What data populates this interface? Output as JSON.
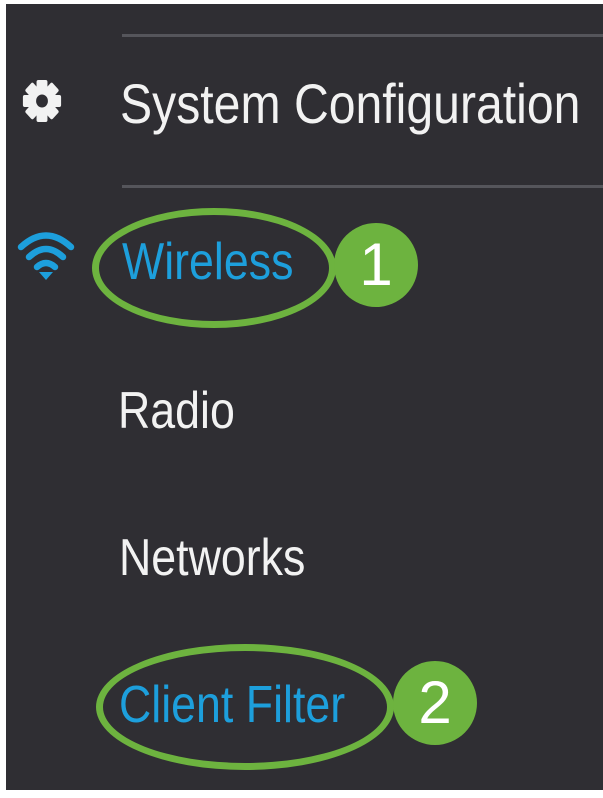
{
  "menu": {
    "system_configuration": "System Configuration",
    "wireless": "Wireless",
    "radio": "Radio",
    "networks": "Networks",
    "client_filter": "Client Filter"
  },
  "icons": {
    "system_configuration": "gear-icon",
    "wireless": "wifi-icon"
  },
  "annotations": {
    "step1": "1",
    "step2": "2"
  },
  "colors": {
    "background": "#2f2e33",
    "active_text": "#1d9fdc",
    "text": "#f2f2f2",
    "annotation": "#6db33f"
  }
}
